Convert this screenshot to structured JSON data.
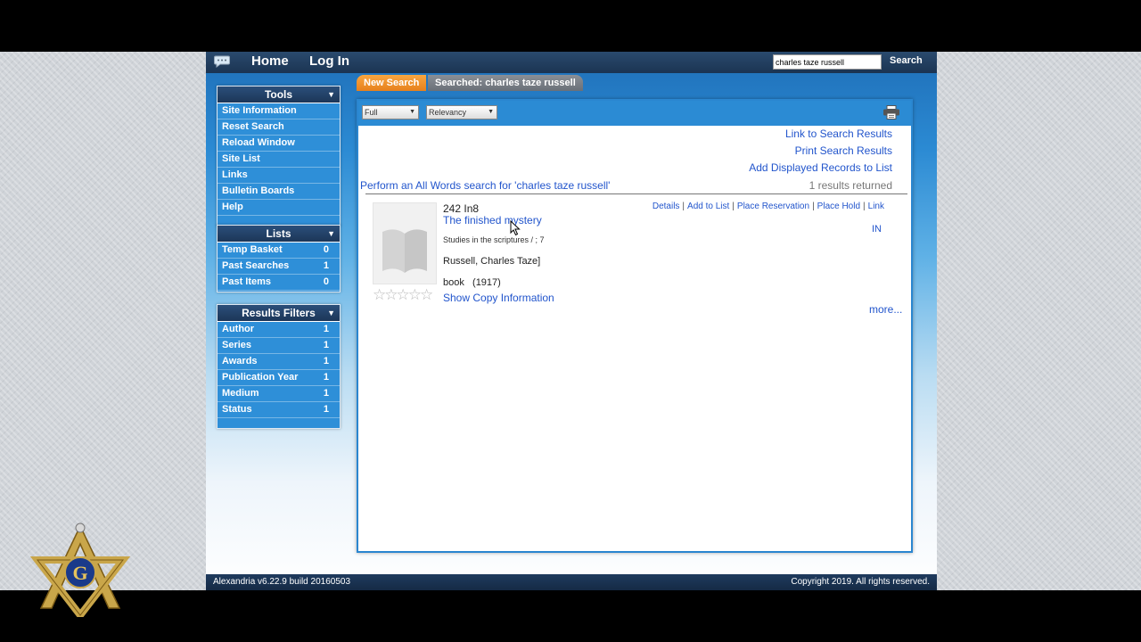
{
  "topbar": {
    "home": "Home",
    "login": "Log In",
    "search_value": "charles taze russell",
    "search_button": "Search"
  },
  "sidebar": {
    "tools": {
      "title": "Tools",
      "items": [
        "Site Information",
        "Reset Search",
        "Reload Window",
        "Site List",
        "Links",
        "Bulletin Boards",
        "Help"
      ]
    },
    "lists": {
      "title": "Lists",
      "items": [
        {
          "label": "Temp Basket",
          "count": "0"
        },
        {
          "label": "Past Searches",
          "count": "1"
        },
        {
          "label": "Past Items",
          "count": "0"
        }
      ]
    },
    "filters": {
      "title": "Results Filters",
      "items": [
        {
          "label": "Author",
          "count": "1"
        },
        {
          "label": "Series",
          "count": "1"
        },
        {
          "label": "Awards",
          "count": "1"
        },
        {
          "label": "Publication Year",
          "count": "1"
        },
        {
          "label": "Medium",
          "count": "1"
        },
        {
          "label": "Status",
          "count": "1"
        }
      ]
    }
  },
  "tabs": {
    "new_search": "New Search",
    "searched": "Searched: charles taze russell"
  },
  "toolbar": {
    "view_select": "Full",
    "sort_select": "Relevancy"
  },
  "result_links": {
    "link_results": "Link to Search Results",
    "print_results": "Print Search Results",
    "add_records": "Add Displayed Records to List"
  },
  "all_words": "Perform an All Words search for 'charles taze russell'",
  "results_returned": "1 results returned",
  "record": {
    "call_number": "242 In8",
    "title": "The finished mystery",
    "series": "Studies in the scriptures / ; 7",
    "author": "Russell, Charles Taze]",
    "format": "book",
    "year": "(1917)",
    "copy_info": "Show Copy Information",
    "status": "IN",
    "more": "more...",
    "actions": [
      "Details",
      "Add to List",
      "Place Reservation",
      "Place Hold",
      "Link"
    ]
  },
  "footer": {
    "version": "Alexandria v6.22.9 build 20160503",
    "copyright": "Copyright 2019. All rights reserved."
  },
  "icons": [
    "chat-icon",
    "printer-icon",
    "book-icon",
    "star-icon",
    "mouse-cursor-icon",
    "masonic-emblem"
  ]
}
